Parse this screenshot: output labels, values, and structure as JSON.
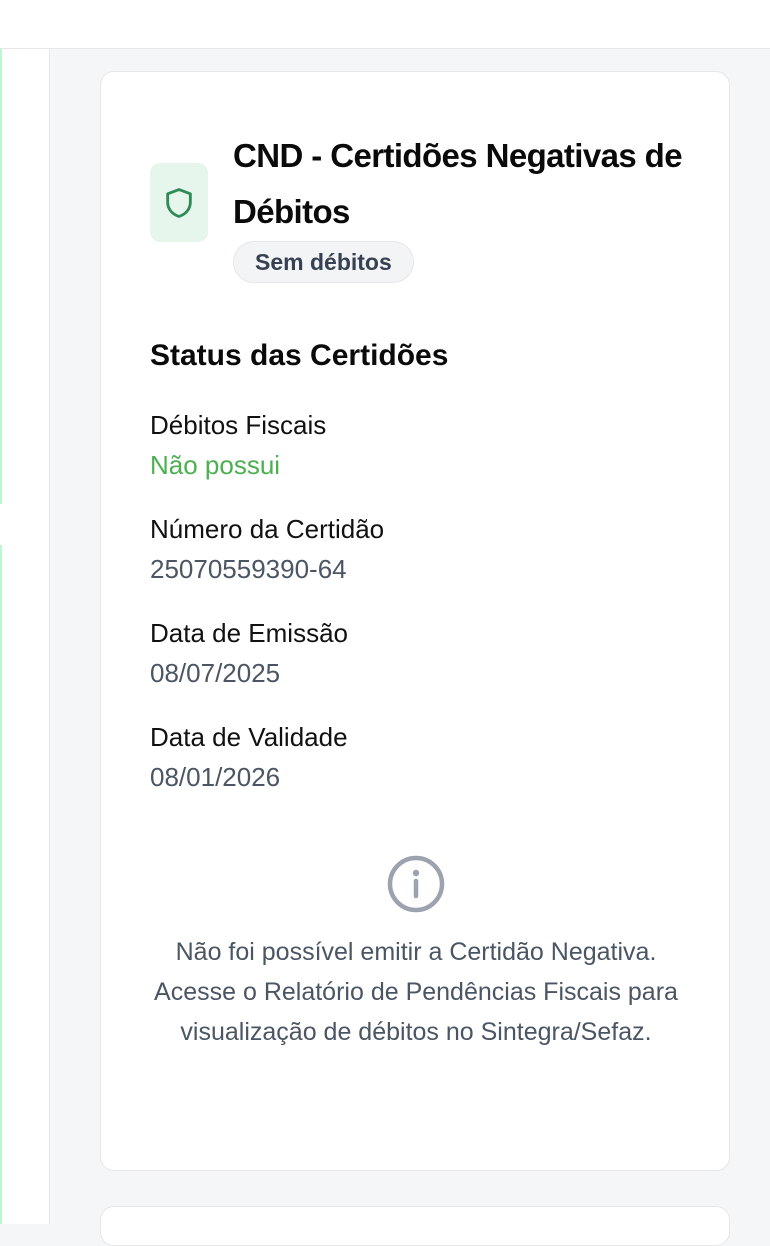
{
  "card": {
    "title": "CND - Certidões Negativas de Débitos",
    "icon": "shield-icon",
    "badge": "Sem débitos",
    "section_title": "Status das Certidões",
    "fields": [
      {
        "label": "Débitos Fiscais",
        "value": "Não possui"
      },
      {
        "label": "Número da Certidão",
        "value": "25070559390-64"
      },
      {
        "label": "Data de Emissão",
        "value": "08/07/2025"
      },
      {
        "label": "Data de Validade",
        "value": "08/01/2026"
      }
    ],
    "info_icon": "info-icon",
    "info_message": "Não foi possível emitir a Certidão Negativa. Acesse o Relatório de Pendências Fiscais para visualização de débitos no Sintegra/Sefaz."
  },
  "colors": {
    "accent_green": "#4caf50",
    "icon_tile_bg": "#e7f6ec",
    "shield_stroke": "#2e8b57",
    "muted_text": "#4b5563",
    "info_icon": "#9ca3af"
  }
}
